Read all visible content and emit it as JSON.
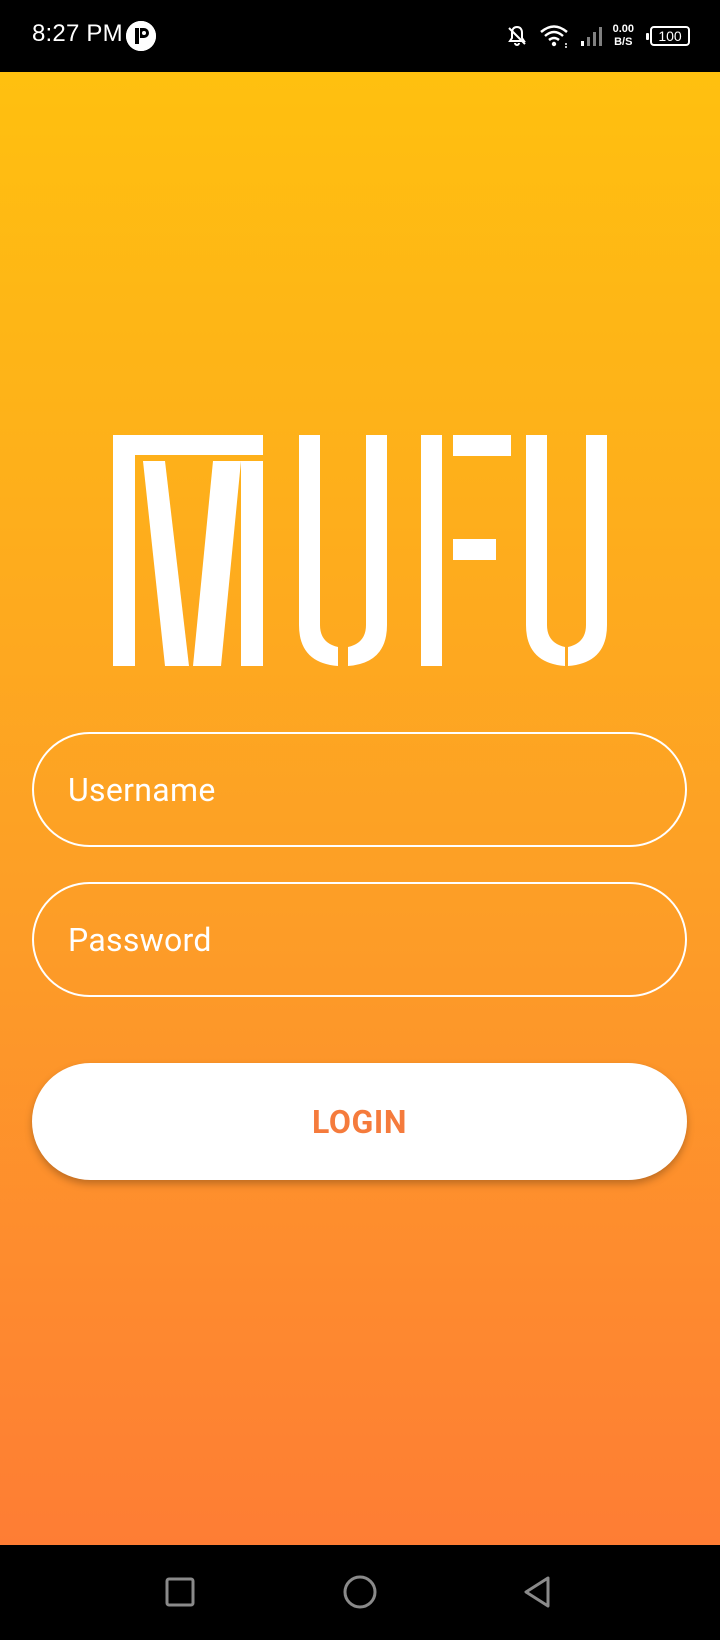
{
  "status_bar": {
    "time": "8:27 PM",
    "net_speed_value": "0.00",
    "net_speed_unit": "B/S",
    "battery": "100",
    "icons": [
      "app-notification-icon",
      "bell-muted-icon",
      "wifi-icon",
      "cell-signal-icon",
      "battery-icon"
    ]
  },
  "app": {
    "logo_text": "MUFU"
  },
  "login_form": {
    "username_placeholder": "Username",
    "password_placeholder": "Password",
    "login_label": "LOGIN"
  },
  "nav_bar": {
    "icons": [
      "recents-icon",
      "home-icon",
      "back-icon"
    ]
  },
  "colors": {
    "gradient_top": "#ffc00f",
    "gradient_bottom": "#fe7d34",
    "button_text": "#f57b3c"
  }
}
